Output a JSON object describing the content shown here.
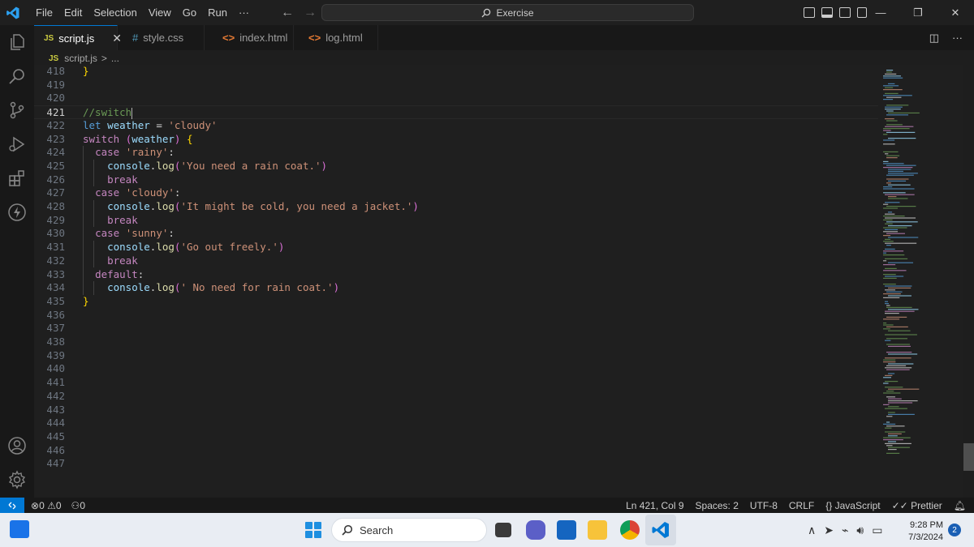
{
  "app": {
    "search_text": "Exercise"
  },
  "menu": [
    "File",
    "Edit",
    "Selection",
    "View",
    "Go",
    "Run",
    "···"
  ],
  "tabs": [
    {
      "icon": "JS",
      "label": "script.js",
      "active": true
    },
    {
      "icon": "#",
      "label": "style.css"
    },
    {
      "icon": "<>",
      "label": "index.html"
    },
    {
      "icon": "<>",
      "label": "log.html"
    }
  ],
  "breadcrumb": {
    "icon": "JS",
    "file": "script.js",
    "sep": ">",
    "more": "..."
  },
  "editor": {
    "lines": [
      {
        "n": "418",
        "code": "}"
      },
      {
        "n": "419",
        "code": ""
      },
      {
        "n": "420",
        "code": ""
      },
      {
        "n": "421",
        "code": "//switch"
      },
      {
        "n": "422",
        "code": "let weather = 'cloudy'"
      },
      {
        "n": "423",
        "code": "switch (weather) {"
      },
      {
        "n": "424",
        "code": "  case 'rainy':"
      },
      {
        "n": "425",
        "code": "    console.log('You need a rain coat.')"
      },
      {
        "n": "426",
        "code": "    break"
      },
      {
        "n": "427",
        "code": "  case 'cloudy':"
      },
      {
        "n": "428",
        "code": "    console.log('It might be cold, you need a jacket.')"
      },
      {
        "n": "429",
        "code": "    break"
      },
      {
        "n": "430",
        "code": "  case 'sunny':"
      },
      {
        "n": "431",
        "code": "    console.log('Go out freely.')"
      },
      {
        "n": "432",
        "code": "    break"
      },
      {
        "n": "433",
        "code": "  default:"
      },
      {
        "n": "434",
        "code": "    console.log(' No need for rain coat.')"
      },
      {
        "n": "435",
        "code": "}"
      },
      {
        "n": "436",
        "code": ""
      },
      {
        "n": "437",
        "code": ""
      },
      {
        "n": "438",
        "code": ""
      },
      {
        "n": "439",
        "code": ""
      },
      {
        "n": "440",
        "code": ""
      },
      {
        "n": "441",
        "code": ""
      },
      {
        "n": "442",
        "code": ""
      },
      {
        "n": "443",
        "code": ""
      },
      {
        "n": "444",
        "code": ""
      },
      {
        "n": "445",
        "code": ""
      },
      {
        "n": "446",
        "code": ""
      },
      {
        "n": "447",
        "code": ""
      }
    ]
  },
  "status": {
    "errors": "0",
    "warnings": "0",
    "ports": "0",
    "position": "Ln 421, Col 9",
    "spaces": "Spaces: 2",
    "encoding": "UTF-8",
    "eol": "CRLF",
    "language": "JavaScript",
    "formatter": "Prettier"
  },
  "taskbar": {
    "search_placeholder": "Search",
    "time": "9:28 PM",
    "date": "7/3/2024",
    "notifications": "2"
  },
  "colors": {
    "accent": "#0078d4"
  }
}
